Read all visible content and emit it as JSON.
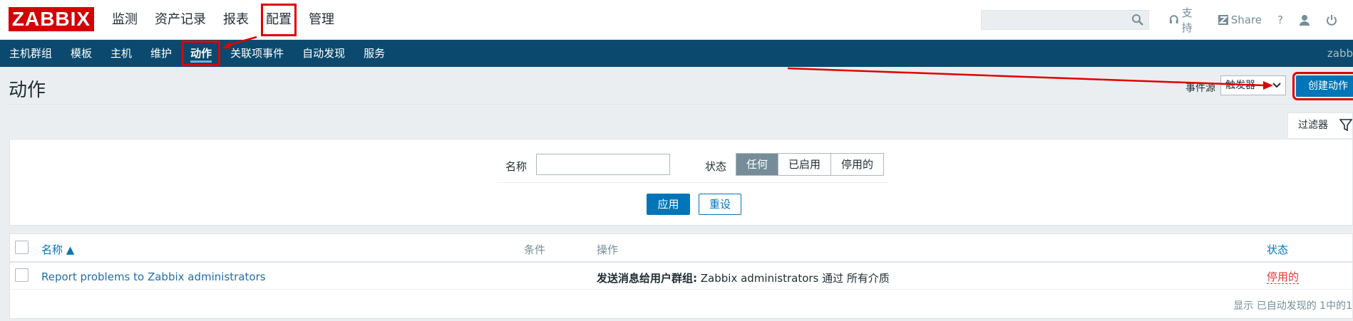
{
  "logo": "ZABBIX",
  "main_menu": [
    "监测",
    "资产记录",
    "报表",
    "配置",
    "管理"
  ],
  "top_links": {
    "support": "支持",
    "share": "Share",
    "help": "?"
  },
  "sub_nav": [
    "主机群组",
    "模板",
    "主机",
    "维护",
    "动作",
    "关联项事件",
    "自动发现",
    "服务"
  ],
  "user_fragment": "zabb",
  "page": {
    "title": "动作",
    "event_source_label": "事件源",
    "event_source_value": "触发器",
    "create_button": "创建动作"
  },
  "filter": {
    "tab_label": "过滤器",
    "name_label": "名称",
    "name_value": "",
    "status_label": "状态",
    "status_options": [
      "任何",
      "已启用",
      "停用的"
    ],
    "status_selected": "任何",
    "apply": "应用",
    "reset": "重设"
  },
  "table": {
    "headers": {
      "name": "名称 ▲",
      "conditions": "条件",
      "operations": "操作",
      "status": "状态"
    },
    "rows": [
      {
        "name": "Report problems to Zabbix administrators",
        "conditions": "",
        "operation_bold": "发送消息给用户群组:",
        "operation_rest": " Zabbix administrators 通过 所有介质",
        "status": "停用的"
      }
    ],
    "footer": "显示 已自动发现的 1中的1"
  },
  "colors": {
    "logo_red": "#d40000",
    "nav_blue": "#0b4a6e",
    "primary": "#0275b8",
    "annotation_red": "#e00000",
    "status_red": "#e33734"
  }
}
